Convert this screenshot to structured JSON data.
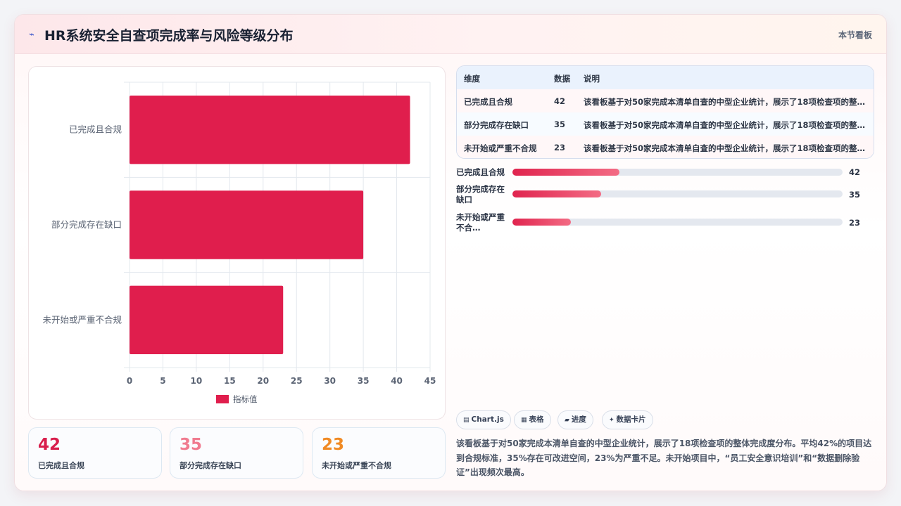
{
  "header": {
    "title": "HR系统安全自查项完成率与风险等级分布",
    "tag": "本节看板"
  },
  "chart_data": {
    "type": "bar",
    "orientation": "horizontal",
    "categories": [
      "已完成且合规",
      "部分完成存在缺口",
      "未开始或严重不合规"
    ],
    "series": [
      {
        "name": "指标值",
        "values": [
          42,
          35,
          23
        ],
        "color": "#e01e4d"
      }
    ],
    "xlim": [
      0,
      45
    ],
    "xticks": [
      0,
      5,
      10,
      15,
      20,
      25,
      30,
      35,
      40,
      45
    ],
    "grid": true,
    "legend": "bottom"
  },
  "kpis": [
    {
      "value": "42",
      "label": "已完成且合规",
      "color": "#d81e4c"
    },
    {
      "value": "35",
      "label": "部分完成存在缺口",
      "color": "#f07b8f"
    },
    {
      "value": "23",
      "label": "未开始或严重不合规",
      "color": "#f08a24"
    }
  ],
  "table": {
    "headers": [
      "维度",
      "数据",
      "说明"
    ],
    "rows": [
      [
        "已完成且合规",
        "42",
        "该看板基于对50家完成本清单自查的中型企业统计，展示了18项检查项的整体完成度分布。"
      ],
      [
        "部分完成存在缺口",
        "35",
        "该看板基于对50家完成本清单自查的中型企业统计，展示了18项检查项的整体完成度分布。"
      ],
      [
        "未开始或严重不合规",
        "23",
        "该看板基于对50家完成本清单自查的中型企业统计，展示了18项检查项的整体完成度分布。"
      ]
    ]
  },
  "progress": {
    "max": 130,
    "items": [
      {
        "label": "已完成且合规",
        "value": 42
      },
      {
        "label": "部分完成存在缺口",
        "value": 35
      },
      {
        "label": "未开始或严重不合…",
        "value": 23
      }
    ]
  },
  "chips": [
    {
      "icon": "▤",
      "icon_name": "chart-icon",
      "label": "Chart.js"
    },
    {
      "icon": "▦",
      "icon_name": "table-icon",
      "label": "表格"
    },
    {
      "icon": "▰",
      "icon_name": "progress-icon",
      "label": "进度"
    },
    {
      "icon": "✦",
      "icon_name": "sparkle-icon",
      "label": "数据卡片"
    }
  ],
  "summary": "该看板基于对50家完成本清单自查的中型企业统计，展示了18项检查项的整体完成度分布。平均42%的项目达到合规标准，35%存在可改进空间，23%为严重不足。未开始项目中，“员工安全意识培训”和“数据删除验证”出现频次最高。"
}
